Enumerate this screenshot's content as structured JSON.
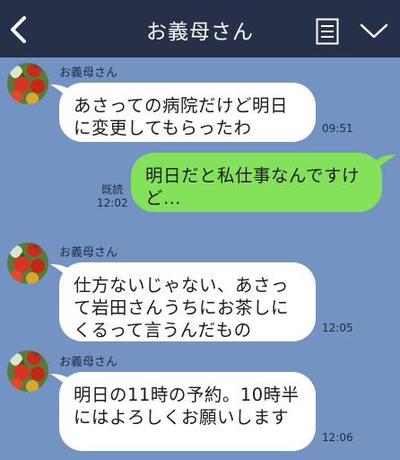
{
  "header": {
    "title": "お義母さん"
  },
  "messages": [
    {
      "sender": "お義母さん",
      "text": "あさっての病院だけど明日に変更してもらったわ",
      "time": "09:51"
    },
    {
      "text": "明日だと私仕事なんですけど…",
      "read": "既読",
      "time": "12:02"
    },
    {
      "sender": "お義母さん",
      "text": "仕方ないじゃない、あさって岩田さんうちにお茶しにくるって言うんだもの",
      "time": "12:05"
    },
    {
      "sender": "お義母さん",
      "text": "明日の11時の予約。10時半にはよろしくお願いします",
      "time": "12:06"
    }
  ],
  "colors": {
    "background": "#7393c3",
    "header": "#263149",
    "incoming_bubble": "#ffffff",
    "outgoing_bubble": "#84e15a"
  },
  "icons": [
    "back-icon",
    "menu-icon",
    "chevron-down-icon",
    "tomato-avatar"
  ]
}
